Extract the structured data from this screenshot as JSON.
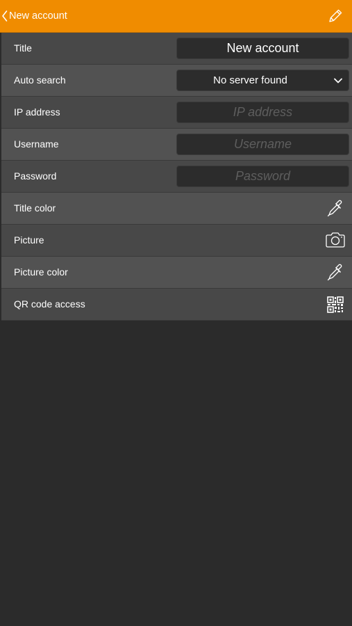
{
  "header": {
    "back_label": "New account",
    "back_icon": "chevron-left-icon",
    "edit_icon": "pencil-icon",
    "color": "#f08c00"
  },
  "form": {
    "title": {
      "label": "Title",
      "value": "New account"
    },
    "auto_search": {
      "label": "Auto search",
      "selected": "No server found"
    },
    "ip_address": {
      "label": "IP address",
      "placeholder": "IP address"
    },
    "username": {
      "label": "Username",
      "placeholder": "Username"
    },
    "password": {
      "label": "Password",
      "placeholder": "Password"
    },
    "title_color": {
      "label": "Title color",
      "icon": "eyedropper-icon"
    },
    "picture": {
      "label": "Picture",
      "icon": "camera-icon"
    },
    "picture_color": {
      "label": "Picture color",
      "icon": "eyedropper-icon"
    },
    "qr_code": {
      "label": "QR code access",
      "icon": "qr-code-icon"
    }
  }
}
